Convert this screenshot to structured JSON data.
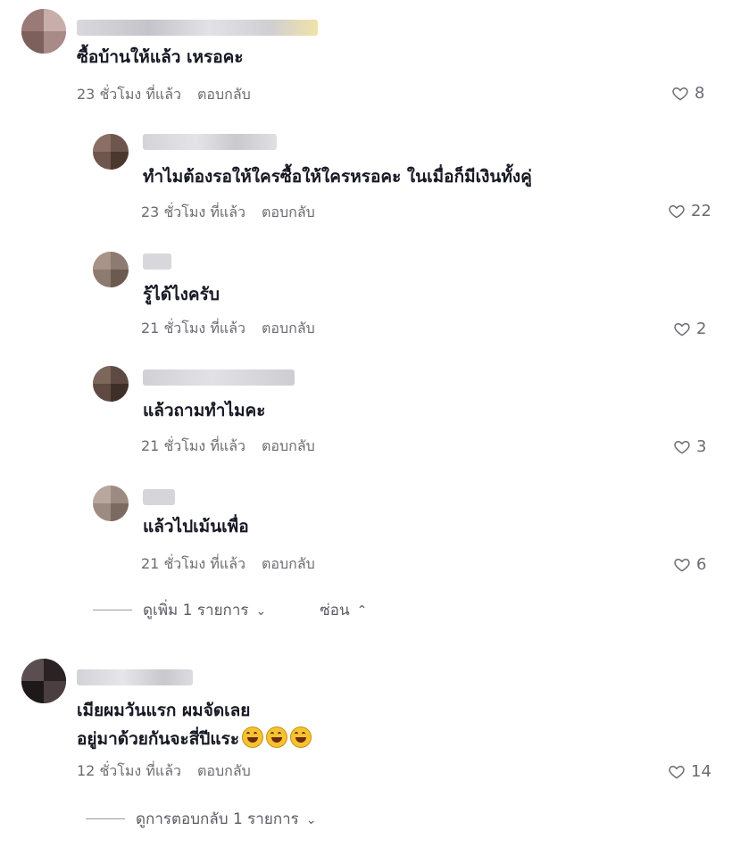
{
  "comments": [
    {
      "text": "ซื้อบ้านให้แล้ว เหรอคะ",
      "time": "23 ชั่วโมง ที่แล้ว",
      "reply_label": "ตอบกลับ",
      "likes": "8",
      "replies": [
        {
          "text": "ทำไมต้องรอให้ใครซื้อให้ใครหรอคะ ในเมื่อก็มีเงินทั้งคู่",
          "time": "23 ชั่วโมง ที่แล้ว",
          "reply_label": "ตอบกลับ",
          "likes": "22"
        },
        {
          "text": "รู้ได้ไงครับ",
          "time": "21 ชั่วโมง ที่แล้ว",
          "reply_label": "ตอบกลับ",
          "likes": "2"
        },
        {
          "text": "แล้วถามทำไมคะ",
          "time": "21 ชั่วโมง ที่แล้ว",
          "reply_label": "ตอบกลับ",
          "likes": "3"
        },
        {
          "text": "แล้วไปเม้นเพื่อ",
          "time": "21 ชั่วโมง ที่แล้ว",
          "reply_label": "ตอบกลับ",
          "likes": "6"
        }
      ],
      "view_more_label": "ดูเพิ่ม 1 รายการ",
      "hide_label": "ซ่อน"
    },
    {
      "text_line1": "เมียผมวันแรก ผมจัดเลย",
      "text_line2": "อยู่มาด้วยกันจะสี่ปีแระ",
      "emojis": [
        "grinning-squinting-face",
        "grinning-squinting-face",
        "grinning-squinting-face"
      ],
      "time": "12 ชั่วโมง ที่แล้ว",
      "reply_label": "ตอบกลับ",
      "likes": "14",
      "view_replies_label": "ดูการตอบกลับ 1 รายการ"
    }
  ],
  "colors": {
    "text": "#161823",
    "meta": "#6b6b73",
    "emoji": "#f6c232"
  }
}
